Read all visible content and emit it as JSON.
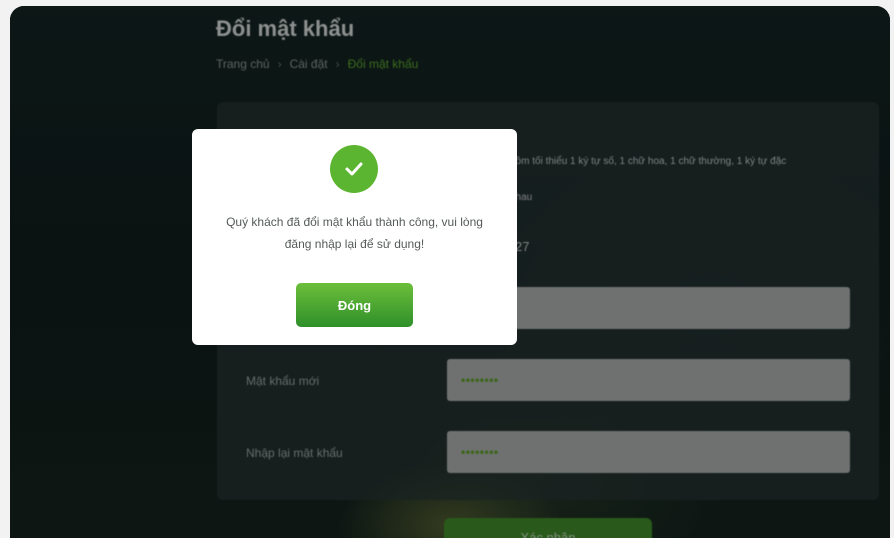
{
  "page": {
    "title": "Đổi mật khẩu",
    "breadcrumb": [
      "Trang chủ",
      "Cài đặt",
      "Đổi mật khẩu"
    ]
  },
  "form": {
    "hint_1": "gồm tối thiểu 1 ký tự số, 1 chữ hoa, 1 chữ thường, 1 ký tự đặc",
    "hint_2": "nhau",
    "hint_3": "27",
    "new_password_label": "Mật khẩu mới",
    "new_password_value": "••••••••",
    "confirm_password_label": "Nhập lại mật khẩu",
    "confirm_password_value": "••••••••",
    "submit_label": "Xác nhận"
  },
  "modal": {
    "icon": "check-icon",
    "message": "Quý khách đã đổi mật khẩu thành công, vui lòng đăng nhập lại để sử dụng!",
    "close_label": "Đóng"
  },
  "colors": {
    "accent": "#5cb531",
    "background": "#0f1e1c",
    "modal_bg": "#ffffff"
  }
}
